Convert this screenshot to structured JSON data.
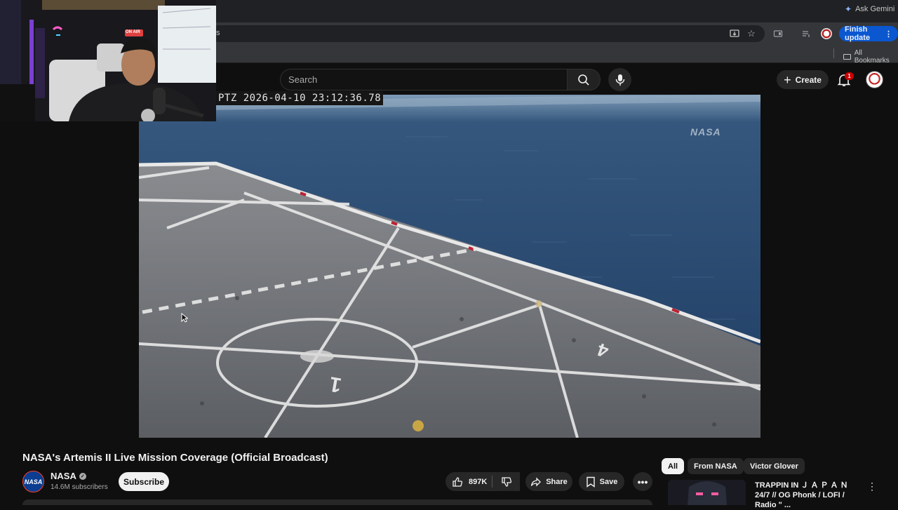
{
  "browser": {
    "gemini_label": "Ask Gemini",
    "finish_update_label": "Finish update",
    "all_bookmarks_label": "All Bookmarks",
    "tab_fragment": "s"
  },
  "header": {
    "search_placeholder": "Search",
    "create_label": "Create",
    "notification_count": "1"
  },
  "video": {
    "timestamp_overlay": "PTZ 2026-04-10 23:12:36.78",
    "watermark": "NASA",
    "title": "NASA's Artemis II Live Mission Coverage (Official Broadcast)"
  },
  "channel": {
    "avatar_text": "NASA",
    "name": "NASA",
    "subscribers": "14.6M subscribers",
    "subscribe_label": "Subscribe"
  },
  "actions": {
    "like_count": "897K",
    "share_label": "Share",
    "save_label": "Save"
  },
  "webcam": {
    "on_air_label": "ON AIR"
  },
  "sidebar": {
    "chips": [
      {
        "label": "All",
        "active": true
      },
      {
        "label": "From NASA",
        "active": false
      },
      {
        "label": "Victor Glover",
        "active": false
      }
    ],
    "recommendation": {
      "title": "TRAPPIN IN Ｊ Ａ Ｐ Ａ Ｎ 24/7 // OG Phonk / LOFI / Radio \" ..."
    }
  },
  "colors": {
    "background": "#0f0f0f",
    "accent_blue": "#0b57d0",
    "notification_red": "#cc0000",
    "chip_active": "#f1f1f1"
  }
}
